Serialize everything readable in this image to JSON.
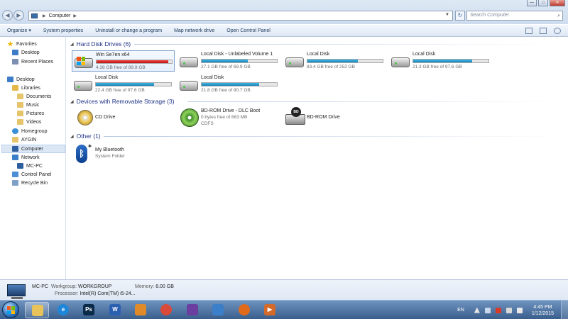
{
  "window": {
    "controls": {
      "minimize": "—",
      "maximize": "□",
      "close": "✕"
    },
    "address_path": [
      "Computer"
    ],
    "search_placeholder": "Search Computer"
  },
  "toolbar": {
    "commands": [
      "Organize ▾",
      "System properties",
      "Uninstall or change a program",
      "Map network drive",
      "Open Control Panel"
    ]
  },
  "nav": {
    "items": [
      {
        "label": "Favorites",
        "icon": "favorites-star-icon",
        "color": "#f0b400"
      },
      {
        "label": "Desktop",
        "icon": "desktop-icon",
        "color": "#3f7cc8"
      },
      {
        "label": "Recent Places",
        "icon": "recent-places-icon",
        "color": "#7a8fb1"
      },
      {
        "label": "Desktop",
        "icon": "desktop-icon",
        "color": "#3f7cc8"
      },
      {
        "label": "Libraries",
        "icon": "libraries-icon",
        "color": "#e6b84a"
      },
      {
        "label": "Documents",
        "icon": "documents-icon",
        "color": "#e6c46a"
      },
      {
        "label": "Music",
        "icon": "music-icon",
        "color": "#e6c46a"
      },
      {
        "label": "Pictures",
        "icon": "pictures-icon",
        "color": "#e6c46a"
      },
      {
        "label": "Videos",
        "icon": "videos-icon",
        "color": "#e6c46a"
      },
      {
        "label": "Homegroup",
        "icon": "homegroup-icon",
        "color": "#3a8fd6"
      },
      {
        "label": "AYGIN",
        "icon": "user-folder-icon",
        "color": "#e6c46a"
      },
      {
        "label": "Computer",
        "icon": "computer-icon",
        "color": "#2f5f9e"
      },
      {
        "label": "Network",
        "icon": "network-icon",
        "color": "#3a7fc8"
      },
      {
        "label": "MC-PC",
        "icon": "network-pc-icon",
        "color": "#2f5f9e"
      },
      {
        "label": "Control Panel",
        "icon": "control-panel-icon",
        "color": "#4c8fd6"
      },
      {
        "label": "Recycle Bin",
        "icon": "recycle-bin-icon",
        "color": "#7fa1c8"
      }
    ]
  },
  "groups": {
    "hdd": "Hard Disk Drives (6)",
    "removable": "Devices with Removable Storage (3)",
    "other": "Other (1)"
  },
  "drives": [
    {
      "name": "Win Se7en x64",
      "free": "4.38 GB free of 89.9 GB",
      "used_fraction": 0.95,
      "bar_color": "#d81e1e"
    },
    {
      "name": "Local Disk - Unlabeled Volume 1",
      "free": "27.1 GB free of 69.9 GB",
      "used_fraction": 0.61,
      "bar_color": "#1f8fc6"
    },
    {
      "name": "Local Disk",
      "free": "83.4 GB free of 252 GB",
      "used_fraction": 0.67,
      "bar_color": "#1f8fc6"
    },
    {
      "name": "Local Disk",
      "free": "21.3 GB free of 97.6 GB",
      "used_fraction": 0.78,
      "bar_color": "#1f8fc6"
    },
    {
      "name": "Local Disk",
      "free": "22.4 GB free of 97.6 GB",
      "used_fraction": 0.77,
      "bar_color": "#1f8fc6"
    },
    {
      "name": "Local Disk",
      "free": "21.8 GB free of 90.7 GB",
      "used_fraction": 0.76,
      "bar_color": "#1f8fc6"
    }
  ],
  "removable": [
    {
      "name": "CD Drive",
      "line2": "",
      "line3": ""
    },
    {
      "name": "BD-ROM Drive - DLC Boot",
      "line2": "0 bytes free of 683 MB",
      "line3": "CDFS"
    },
    {
      "name": "BD-ROM Drive",
      "line2": "",
      "line3": ""
    }
  ],
  "other": [
    {
      "name": "My Bluetooth",
      "type": "System Folder"
    }
  ],
  "details": {
    "pc_name": "MC-PC",
    "workgroup_label": "Workgroup:",
    "workgroup": "WORKGROUP",
    "memory_label": "Memory:",
    "memory": "8.00 GB",
    "processor_label": "Processor:",
    "processor": "Intel(R) Core(TM) i5-24..."
  },
  "taskbar": {
    "apps": [
      {
        "name": "windows-explorer",
        "glyph": "",
        "color": "#e8c35a"
      },
      {
        "name": "internet-explorer",
        "glyph": "e",
        "color": "#1e86d8"
      },
      {
        "name": "photoshop",
        "glyph": "Ps",
        "color": "#0a2a4a"
      },
      {
        "name": "word",
        "glyph": "W",
        "color": "#2b5fb0"
      },
      {
        "name": "media-app",
        "glyph": "",
        "color": "#e08a2a"
      },
      {
        "name": "chrome",
        "glyph": "",
        "color": "#d94a3a"
      },
      {
        "name": "visual-studio",
        "glyph": "",
        "color": "#6a3fa0"
      },
      {
        "name": "editor-app",
        "glyph": "",
        "color": "#3a7fc8"
      },
      {
        "name": "firefox",
        "glyph": "",
        "color": "#e06a1a"
      },
      {
        "name": "media-player",
        "glyph": "▶",
        "color": "#d46a2a"
      }
    ],
    "lang": "EN",
    "time": "4:45 PM",
    "date": "1/12/2015"
  }
}
